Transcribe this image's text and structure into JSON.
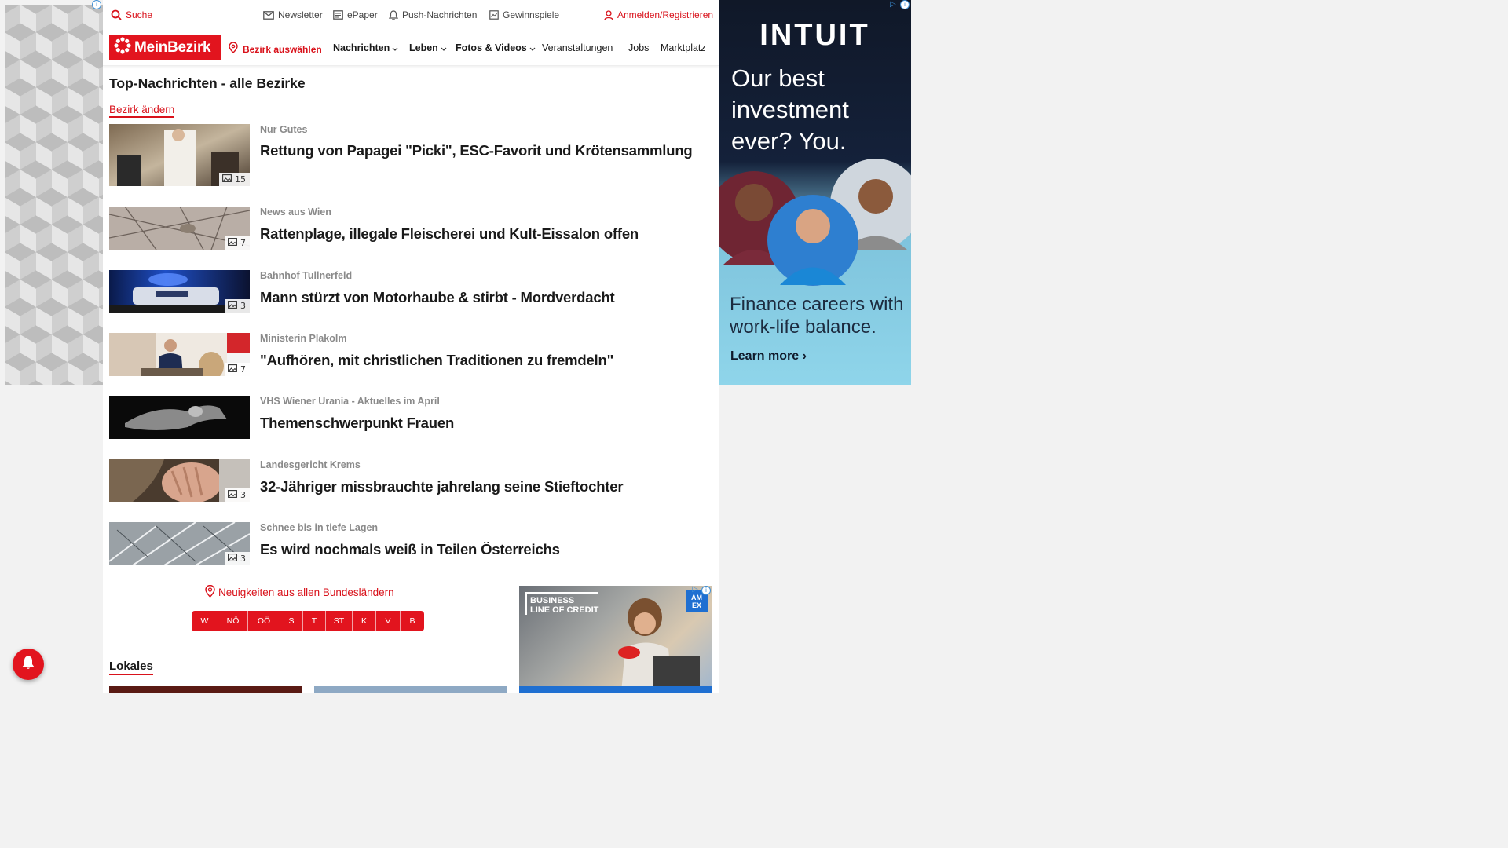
{
  "topbar": {
    "search": "Suche",
    "newsletter": "Newsletter",
    "epaper": "ePaper",
    "push": "Push-Nachrichten",
    "gewinnspiele": "Gewinnspiele",
    "login": "Anmelden/Registrieren"
  },
  "nav": {
    "logo": "MeinBezirk",
    "select_district": "Bezirk auswählen",
    "items": [
      "Nachrichten",
      "Leben",
      "Fotos & Videos",
      "Veranstaltungen",
      "Jobs",
      "Marktplatz"
    ]
  },
  "page": {
    "title": "Top-Nachrichten - alle Bezirke",
    "change_district": "Bezirk ändern"
  },
  "articles": [
    {
      "kicker": "Nur Gutes",
      "headline": "Rettung von Papagei \"Picki\", ESC-Favorit und Krötensammlung",
      "photos": "15"
    },
    {
      "kicker": "News aus Wien",
      "headline": "Rattenplage, illegale Fleischerei und Kult-Eissalon offen",
      "photos": "7"
    },
    {
      "kicker": "Bahnhof Tullnerfeld",
      "headline": "Mann stürzt von Motorhaube & stirbt - Mordverdacht",
      "photos": "3"
    },
    {
      "kicker": "Ministerin Plakolm",
      "headline": "\"Aufhören, mit christlichen Traditionen zu fremdeln\"",
      "photos": "7"
    },
    {
      "kicker": "VHS Wiener Urania - Aktuelles im April",
      "headline": "Themenschwerpunkt Frauen",
      "photos": ""
    },
    {
      "kicker": "Landesgericht Krems",
      "headline": "32-Jähriger missbrauchte jahrelang seine Stieftochter",
      "photos": "3"
    },
    {
      "kicker": "Schnee bis in tiefe Lagen",
      "headline": "Es wird nochmals weiß in Teilen Österreichs",
      "photos": "3"
    }
  ],
  "regions": {
    "label": "Neuigkeiten aus allen Bundesländern",
    "states": [
      "W",
      "NÖ",
      "OÖ",
      "S",
      "T",
      "ST",
      "K",
      "V",
      "B"
    ]
  },
  "lokales": "Lokales",
  "right_ad": {
    "brand": "INTUIT",
    "tagline": "Our best investment ever? You.",
    "careers": "Finance careers with work-life balance.",
    "cta": "Learn more ›"
  },
  "bottom_ad": {
    "line1": "BUSINESS",
    "line2": "LINE OF CREDIT",
    "brand": "AM EX"
  },
  "colors": {
    "brand_red": "#e2141e",
    "kicker_gray": "#8a8a8a"
  }
}
